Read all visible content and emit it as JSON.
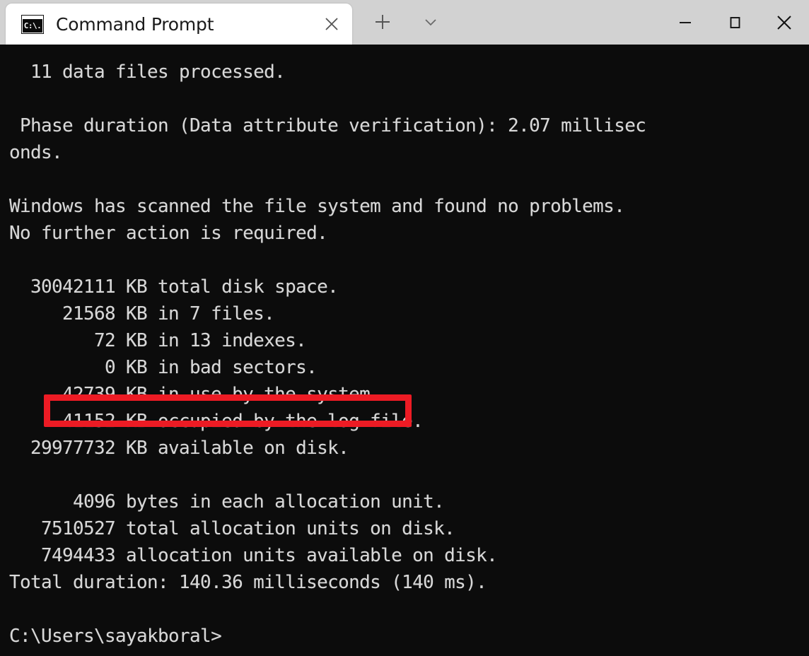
{
  "window": {
    "titlebar_bg": "#d2d2d2",
    "tab": {
      "title": "Command Prompt",
      "icon_label": "C:\\.",
      "close_tooltip": "Close tab"
    },
    "buttons": {
      "new_tab": "+",
      "dropdown": "v",
      "minimize": "Minimize",
      "maximize": "Maximize",
      "close": "Close"
    }
  },
  "terminal": {
    "background": "#0c0c0c",
    "foreground": "#d8d8d8",
    "lines": [
      "  11 data files processed.",
      "",
      " Phase duration (Data attribute verification): 2.07 millisec",
      "onds.",
      "",
      "Windows has scanned the file system and found no problems.",
      "No further action is required.",
      "",
      "  30042111 KB total disk space.",
      "     21568 KB in 7 files.",
      "        72 KB in 13 indexes.",
      "         0 KB in bad sectors.",
      "     42739 KB in use by the system.",
      "     41152 KB occupied by the log file.",
      "  29977732 KB available on disk.",
      "",
      "      4096 bytes in each allocation unit.",
      "   7510527 total allocation units on disk.",
      "   7494433 allocation units available on disk.",
      "Total duration: 140.36 milliseconds (140 ms).",
      "",
      "C:\\Users\\sayakboral>"
    ]
  },
  "annotation": {
    "color": "#ed1b24",
    "highlighted_text": "         0 KB in bad sectors.",
    "shape": "rectangle-outline"
  }
}
